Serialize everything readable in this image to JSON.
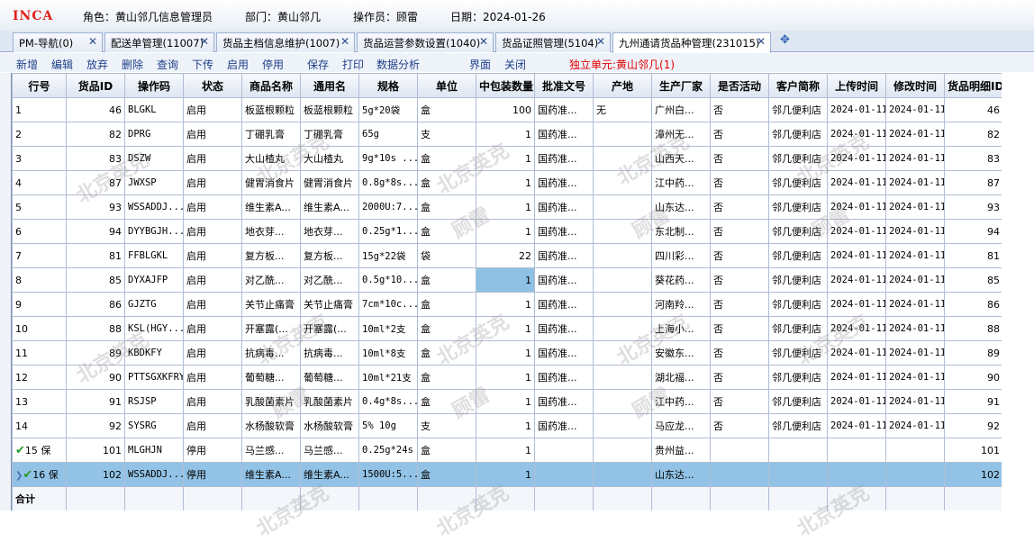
{
  "header": {
    "logo": "INCA",
    "role_label": "角色：",
    "role": "黄山邻几信息管理员",
    "dept_label": "部门：",
    "dept": "黄山邻几",
    "operator_label": "操作员：",
    "operator": "顾雷",
    "date_label": "日期：",
    "date": "2024-01-26"
  },
  "tabs": [
    {
      "label": "PM-导航(0)"
    },
    {
      "label": "配送单管理(11007)"
    },
    {
      "label": "货品主档信息维护(1007)"
    },
    {
      "label": "货品运营参数设置(1040)"
    },
    {
      "label": "货品证照管理(5104)"
    },
    {
      "label": "九州通请货品种管理(231015)"
    }
  ],
  "toolbar": {
    "items": [
      "新增",
      "编辑",
      "放弃",
      "删除",
      "查询",
      "下传",
      "启用",
      "停用",
      "保存",
      "打印",
      "数据分析",
      "界面",
      "关闭"
    ],
    "unit_label": "独立单元:黄山邻几(1)"
  },
  "grid": {
    "columns": [
      "行号",
      "货品ID",
      "操作码",
      "状态",
      "商品名称",
      "通用名",
      "规格",
      "单位",
      "中包装数量",
      "批准文号",
      "产地",
      "生产厂家",
      "是否活动",
      "客户简称",
      "上传时间",
      "修改时间",
      "货品明细ID"
    ],
    "rows": [
      [
        "1",
        "46",
        "BLGKL",
        "启用",
        "板蓝根颗粒",
        "板蓝根颗粒",
        "5g*20袋",
        "盒",
        "100",
        "国药准...",
        "无",
        "广州白...",
        "否",
        "邻几便利店",
        "2024-01-11",
        "2024-01-11",
        "46"
      ],
      [
        "2",
        "82",
        "DPRG",
        "启用",
        "丁硼乳膏",
        "丁硼乳膏",
        "65g",
        "支",
        "1",
        "国药准...",
        "",
        "漳州无...",
        "否",
        "邻几便利店",
        "2024-01-11",
        "2024-01-11",
        "82"
      ],
      [
        "3",
        "83",
        "DSZW",
        "启用",
        "大山楂丸",
        "大山楂丸",
        "9g*10s ...",
        "盒",
        "1",
        "国药准...",
        "",
        "山西天...",
        "否",
        "邻几便利店",
        "2024-01-11",
        "2024-01-11",
        "83"
      ],
      [
        "4",
        "87",
        "JWXSP",
        "启用",
        "健胃消食片",
        "健胃消食片",
        "0.8g*8s...",
        "盒",
        "1",
        "国药准...",
        "",
        "江中药...",
        "否",
        "邻几便利店",
        "2024-01-11",
        "2024-01-11",
        "87"
      ],
      [
        "5",
        "93",
        "WSSADDJ...",
        "启用",
        "维生素A...",
        "维生素A...",
        "2000U:7...",
        "盒",
        "1",
        "国药准...",
        "",
        "山东达...",
        "否",
        "邻几便利店",
        "2024-01-11",
        "2024-01-11",
        "93"
      ],
      [
        "6",
        "94",
        "DYYBGJH...",
        "启用",
        "地衣芽...",
        "地衣芽...",
        "0.25g*1...",
        "盒",
        "1",
        "国药准...",
        "",
        "东北制...",
        "否",
        "邻几便利店",
        "2024-01-11",
        "2024-01-11",
        "94"
      ],
      [
        "7",
        "81",
        "FFBLGKL",
        "启用",
        "复方板...",
        "复方板...",
        "15g*22袋",
        "袋",
        "22",
        "国药准...",
        "",
        "四川彩...",
        "否",
        "邻几便利店",
        "2024-01-11",
        "2024-01-11",
        "81"
      ],
      [
        "8",
        "85",
        "DYXAJFP",
        "启用",
        "对乙酰...",
        "对乙酰...",
        "0.5g*10...",
        "盒",
        "1",
        "国药准...",
        "",
        "葵花药...",
        "否",
        "邻几便利店",
        "2024-01-11",
        "2024-01-11",
        "85"
      ],
      [
        "9",
        "86",
        "GJZTG",
        "启用",
        "关节止痛膏",
        "关节止痛膏",
        "7cm*10c...",
        "盒",
        "1",
        "国药准...",
        "",
        "河南羚...",
        "否",
        "邻几便利店",
        "2024-01-11",
        "2024-01-11",
        "86"
      ],
      [
        "10",
        "88",
        "KSL(HGY...",
        "启用",
        "开塞露(...",
        "开塞露(...",
        "10ml*2支",
        "盒",
        "1",
        "国药准...",
        "",
        "上海小...",
        "否",
        "邻几便利店",
        "2024-01-11",
        "2024-01-11",
        "88"
      ],
      [
        "11",
        "89",
        "KBDKFY",
        "启用",
        "抗病毒...",
        "抗病毒...",
        "10ml*8支",
        "盒",
        "1",
        "国药准...",
        "",
        "安徽东...",
        "否",
        "邻几便利店",
        "2024-01-11",
        "2024-01-11",
        "89"
      ],
      [
        "12",
        "90",
        "PTTSGXKFRY",
        "启用",
        "葡萄糖...",
        "葡萄糖...",
        "10ml*21支",
        "盒",
        "1",
        "国药准...",
        "",
        "湖北福...",
        "否",
        "邻几便利店",
        "2024-01-11",
        "2024-01-11",
        "90"
      ],
      [
        "13",
        "91",
        "RSJSP",
        "启用",
        "乳酸菌素片",
        "乳酸菌素片",
        "0.4g*8s...",
        "盒",
        "1",
        "国药准...",
        "",
        "江中药...",
        "否",
        "邻几便利店",
        "2024-01-11",
        "2024-01-11",
        "91"
      ],
      [
        "14",
        "92",
        "SYSRG",
        "启用",
        "水杨酸软膏",
        "水杨酸软膏",
        "5% 10g",
        "支",
        "1",
        "国药准...",
        "",
        "马应龙...",
        "否",
        "邻几便利店",
        "2024-01-11",
        "2024-01-11",
        "92"
      ],
      [
        "15 保",
        "101",
        "MLGHJN",
        "停用",
        "马兰感...",
        "马兰感...",
        "0.25g*24s",
        "盒",
        "1",
        "",
        "",
        "贵州益...",
        "",
        "",
        "",
        "",
        "101"
      ],
      [
        "16 保",
        "102",
        "WSSADDJ...",
        "停用",
        "维生素A...",
        "维生素A...",
        "1500U:5...",
        "盒",
        "1",
        "",
        "",
        "山东达...",
        "",
        "",
        "",
        "",
        "102"
      ]
    ],
    "total_label": "合计"
  },
  "watermark": {
    "company": "北京英克",
    "user": "顾雷"
  },
  "colors": {
    "accent": "#1f3f88",
    "selected_row": "#92c3e6",
    "logo": "#e0211a",
    "unit": "#e00000",
    "check": "#2a9a2a"
  }
}
